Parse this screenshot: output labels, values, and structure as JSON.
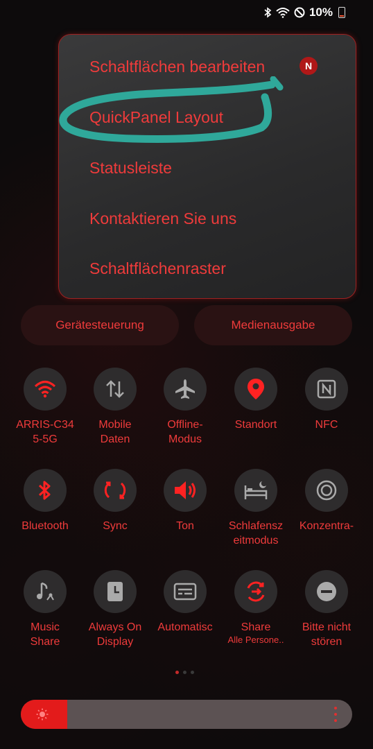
{
  "status": {
    "battery": "10%"
  },
  "menu": {
    "items": [
      "Schaltflächen bearbeiten",
      "QuickPanel Layout",
      "Statusleiste",
      "Kontaktieren Sie uns",
      "Schaltflächenraster"
    ],
    "badge": "N"
  },
  "pills": {
    "device": "Gerätesteuerung",
    "media": "Medienausgabe"
  },
  "tiles": [
    {
      "label": "ARRIS-C34\n5-5G",
      "icon": "wifi-icon"
    },
    {
      "label": "Mobile\nDaten",
      "icon": "mobile-data-icon"
    },
    {
      "label": "Offline-\nModus",
      "icon": "airplane-icon"
    },
    {
      "label": "Standort",
      "icon": "location-pin-icon"
    },
    {
      "label": "NFC",
      "icon": "nfc-icon"
    },
    {
      "label": "Bluetooth",
      "icon": "bluetooth-icon"
    },
    {
      "label": "Sync",
      "icon": "sync-icon"
    },
    {
      "label": "Ton",
      "icon": "speaker-icon"
    },
    {
      "label": "Schlafensz\neitmodus",
      "icon": "sleep-bed-icon"
    },
    {
      "label": "Konzentra-",
      "icon": "focus-icon"
    },
    {
      "label": "Music\nShare",
      "icon": "music-share-icon"
    },
    {
      "label": "Always On\nDisplay",
      "icon": "clock-icon"
    },
    {
      "label": "Automatisc",
      "icon": "caption-icon"
    },
    {
      "label": "Share",
      "sub": "Alle Persone..",
      "icon": "quick-share-icon"
    },
    {
      "label": "Bitte nicht\nstören",
      "icon": "do-not-disturb-icon"
    }
  ],
  "brightness": {
    "level": 0.14
  },
  "colors": {
    "accent": "#ef3b3b",
    "highlight": "#2fa89a"
  }
}
